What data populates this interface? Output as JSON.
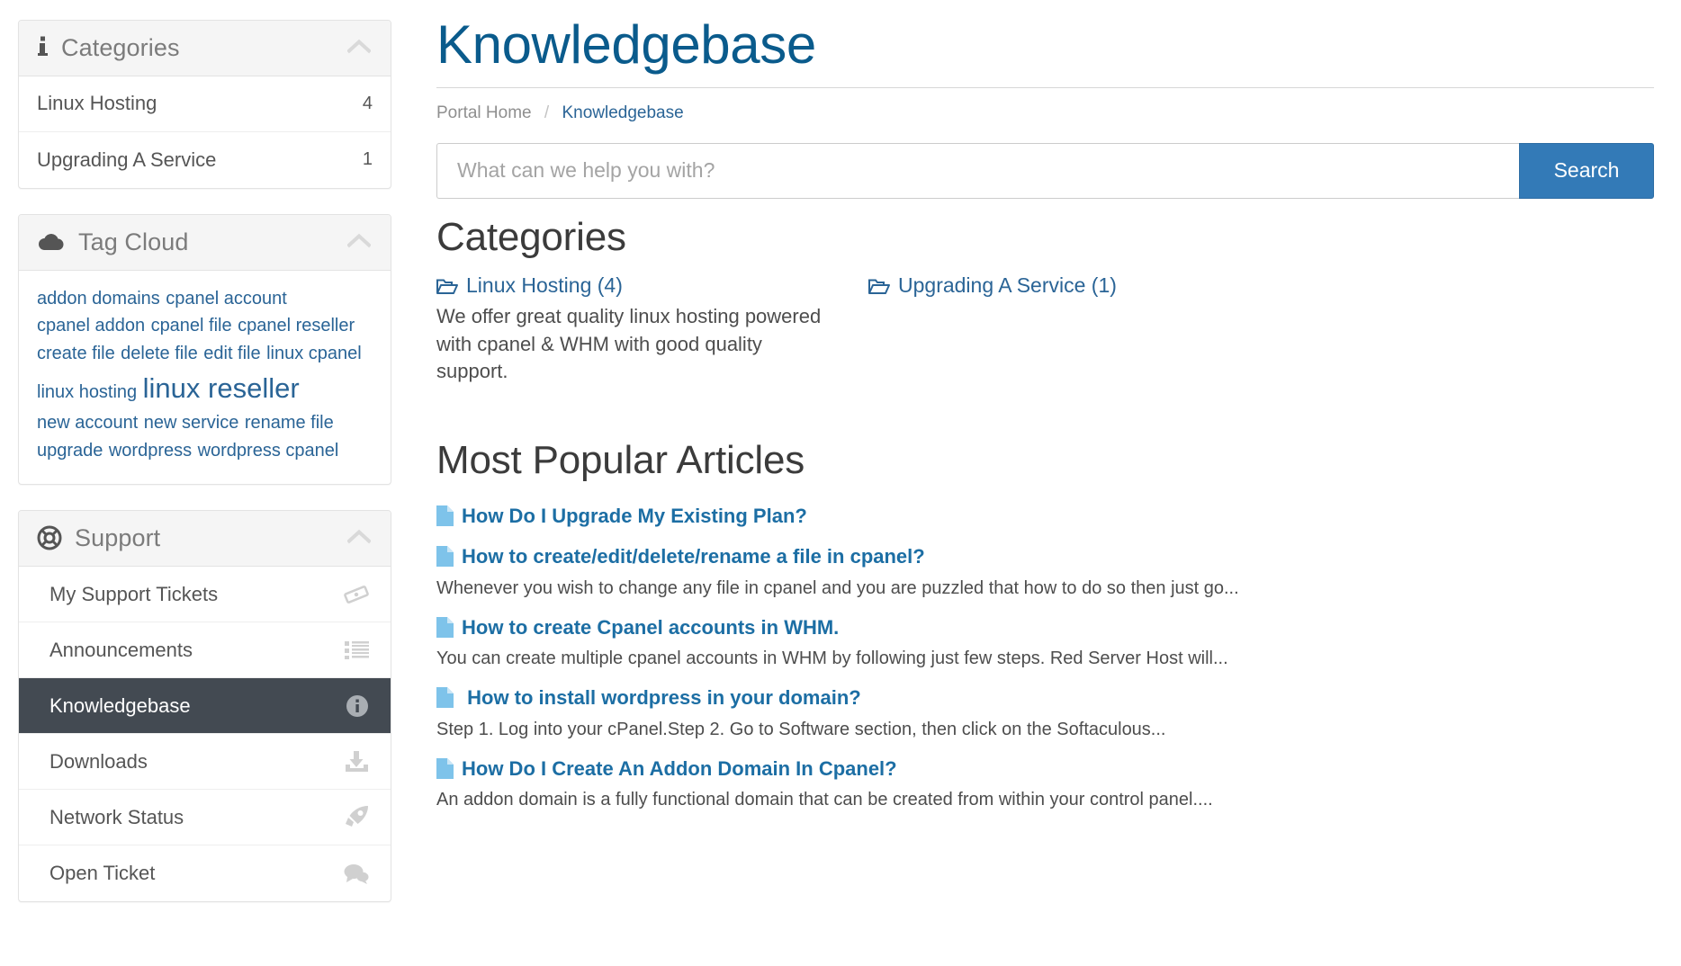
{
  "sidebar": {
    "categories_panel": {
      "icon": "info-icon",
      "title": "Categories",
      "collapse_icon": "chevron-up-icon",
      "items": [
        {
          "label": "Linux Hosting",
          "count": "4"
        },
        {
          "label": "Upgrading A Service",
          "count": "1"
        }
      ]
    },
    "tag_cloud_panel": {
      "icon": "cloud-icon",
      "title": "Tag Cloud",
      "collapse_icon": "chevron-up-icon",
      "tags": [
        {
          "label": "addon domains",
          "size": "normal"
        },
        {
          "label": "cpanel account",
          "size": "normal"
        },
        {
          "label": "cpanel addon",
          "size": "normal"
        },
        {
          "label": "cpanel file",
          "size": "normal"
        },
        {
          "label": "cpanel reseller",
          "size": "normal"
        },
        {
          "label": "create file",
          "size": "normal"
        },
        {
          "label": "delete file",
          "size": "normal"
        },
        {
          "label": "edit file",
          "size": "normal"
        },
        {
          "label": "linux cpanel",
          "size": "normal"
        },
        {
          "label": "linux hosting",
          "size": "normal"
        },
        {
          "label": "linux reseller",
          "size": "big"
        },
        {
          "label": "new account",
          "size": "normal"
        },
        {
          "label": "new service",
          "size": "normal"
        },
        {
          "label": "rename file",
          "size": "normal"
        },
        {
          "label": "upgrade",
          "size": "normal"
        },
        {
          "label": "wordpress",
          "size": "normal"
        },
        {
          "label": "wordpress cpanel",
          "size": "normal"
        }
      ]
    },
    "support_panel": {
      "icon": "life-ring-icon",
      "title": "Support",
      "collapse_icon": "chevron-up-icon",
      "items": [
        {
          "label": "My Support Tickets",
          "icon": "ticket-icon",
          "active": false
        },
        {
          "label": "Announcements",
          "icon": "list-icon",
          "active": false
        },
        {
          "label": "Knowledgebase",
          "icon": "info-circle-icon",
          "active": true
        },
        {
          "label": "Downloads",
          "icon": "download-icon",
          "active": false
        },
        {
          "label": "Network Status",
          "icon": "rocket-icon",
          "active": false
        },
        {
          "label": "Open Ticket",
          "icon": "comments-icon",
          "active": false
        }
      ]
    }
  },
  "main": {
    "page_title": "Knowledgebase",
    "breadcrumb": {
      "home": "Portal Home",
      "separator": "/",
      "current": "Knowledgebase"
    },
    "search": {
      "placeholder": "What can we help you with?",
      "value": "",
      "button_label": "Search"
    },
    "categories_section": {
      "heading": "Categories",
      "items": [
        {
          "icon": "folder-open-icon",
          "label": "Linux Hosting (4)",
          "description": "We offer great quality linux hosting powered with cpanel & WHM with good quality support."
        },
        {
          "icon": "folder-open-icon",
          "label": "Upgrading A Service (1)",
          "description": ""
        }
      ]
    },
    "popular_section": {
      "heading": "Most Popular Articles",
      "articles": [
        {
          "icon": "file-icon",
          "title": "How Do I Upgrade My Existing Plan?",
          "snippet": ""
        },
        {
          "icon": "file-icon",
          "title": "How to create/edit/delete/rename a file in cpanel?",
          "snippet": "Whenever you wish to change any file in cpanel and you are puzzled that how to do so then just go..."
        },
        {
          "icon": "file-icon",
          "title": "How to create Cpanel accounts in WHM.",
          "snippet": "You can create multiple cpanel accounts in WHM by following just few steps. Red Server Host will..."
        },
        {
          "icon": "file-icon",
          "title": " How to install wordpress in your domain?",
          "snippet": "Step 1. Log into your cPanel.Step 2. Go to Software section, then click on the Softaculous..."
        },
        {
          "icon": "file-icon",
          "title": "How Do I Create An Addon Domain In Cpanel?",
          "snippet": "An addon domain is a fully functional domain that can be created from within your control panel...."
        }
      ]
    }
  },
  "colors": {
    "link_blue": "#2a6496",
    "title_blue": "#0a5b8c",
    "button_blue": "#337ab7",
    "active_nav": "#434a52",
    "panel_header_bg": "#f5f5f5",
    "file_icon_blue": "#7ec3ea"
  }
}
